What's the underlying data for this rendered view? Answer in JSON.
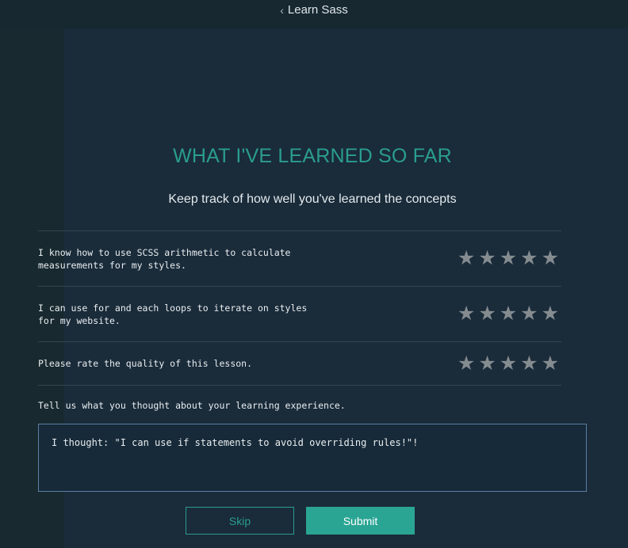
{
  "header": {
    "back_chevron": "‹",
    "back_label": "Learn Sass"
  },
  "main": {
    "title": "WHAT I'VE LEARNED SO FAR",
    "subtitle": "Keep track of how well you've learned the concepts",
    "rating_rows": [
      {
        "label": "I know how to use SCSS arithmetic to calculate measurements for my styles.",
        "stars_max": 5,
        "rating": 0,
        "icon": "star-icon"
      },
      {
        "label": "I can use for and each loops to iterate on styles for my website.",
        "stars_max": 5,
        "rating": 0,
        "icon": "star-icon"
      },
      {
        "label": "Please rate the quality of this lesson.",
        "stars_max": 5,
        "rating": 0,
        "icon": "star-icon"
      }
    ],
    "feedback_label": "Tell us what you thought about your learning experience.",
    "feedback_value": "I thought: \"I can use if statements to avoid overriding rules!\"!"
  },
  "buttons": {
    "skip_label": "Skip",
    "submit_label": "Submit"
  },
  "colors": {
    "accent": "#2a9d8f",
    "background": "#1a2b3a",
    "star_inactive": "#858c90",
    "input_border": "#5a7fa6"
  }
}
